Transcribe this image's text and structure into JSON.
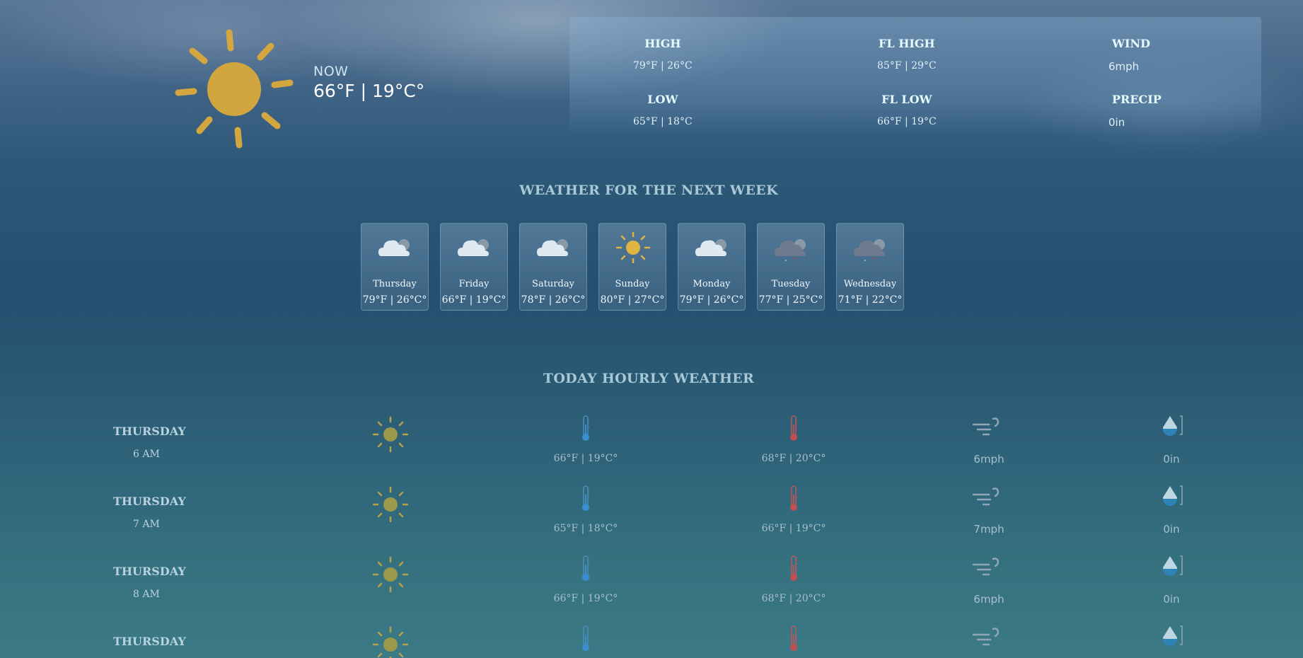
{
  "now": {
    "label": "NOW",
    "temp": "66°F | 19°C°",
    "icon": "sun-icon"
  },
  "stats": {
    "high": {
      "label": "HIGH",
      "value": "79°F | 26°C"
    },
    "low": {
      "label": "LOW",
      "value": "65°F | 18°C"
    },
    "fl_high": {
      "label": "FL HIGH",
      "value": "85°F | 29°C"
    },
    "fl_low": {
      "label": "FL LOW",
      "value": "66°F | 19°C"
    },
    "wind": {
      "label": "WIND",
      "value": "6mph"
    },
    "precip": {
      "label": "PRECIP",
      "value": "0in"
    }
  },
  "week": {
    "title": "WEATHER FOR THE NEXT WEEK",
    "days": [
      {
        "name": "Thursday",
        "temp": "79°F | 26°C°",
        "icon": "cloud-icon"
      },
      {
        "name": "Friday",
        "temp": "66°F | 19°C°",
        "icon": "cloud-icon"
      },
      {
        "name": "Saturday",
        "temp": "78°F | 26°C°",
        "icon": "cloud-icon"
      },
      {
        "name": "Sunday",
        "temp": "80°F | 27°C°",
        "icon": "sun-icon"
      },
      {
        "name": "Monday",
        "temp": "79°F | 26°C°",
        "icon": "cloud-icon"
      },
      {
        "name": "Tuesday",
        "temp": "77°F | 25°C°",
        "icon": "rain-cloud-icon"
      },
      {
        "name": "Wednesday",
        "temp": "71°F | 22°C°",
        "icon": "rain-cloud-icon"
      }
    ]
  },
  "hourly": {
    "title": "TODAY HOURLY WEATHER",
    "rows": [
      {
        "day": "THURSDAY",
        "time": "6 AM",
        "temp": "66°F | 19°C°",
        "feels": "68°F | 20°C°",
        "wind": "6mph",
        "precip": "0in"
      },
      {
        "day": "THURSDAY",
        "time": "7 AM",
        "temp": "65°F | 18°C°",
        "feels": "66°F | 19°C°",
        "wind": "7mph",
        "precip": "0in"
      },
      {
        "day": "THURSDAY",
        "time": "8 AM",
        "temp": "66°F | 19°C°",
        "feels": "68°F | 20°C°",
        "wind": "6mph",
        "precip": "0in"
      },
      {
        "day": "THURSDAY",
        "time": "",
        "temp": "",
        "feels": "",
        "wind": "",
        "precip": ""
      }
    ]
  },
  "colors": {
    "sun": "#d9a93b",
    "thermo_cold": "#3b8fd0",
    "thermo_warm": "#c0504f"
  }
}
